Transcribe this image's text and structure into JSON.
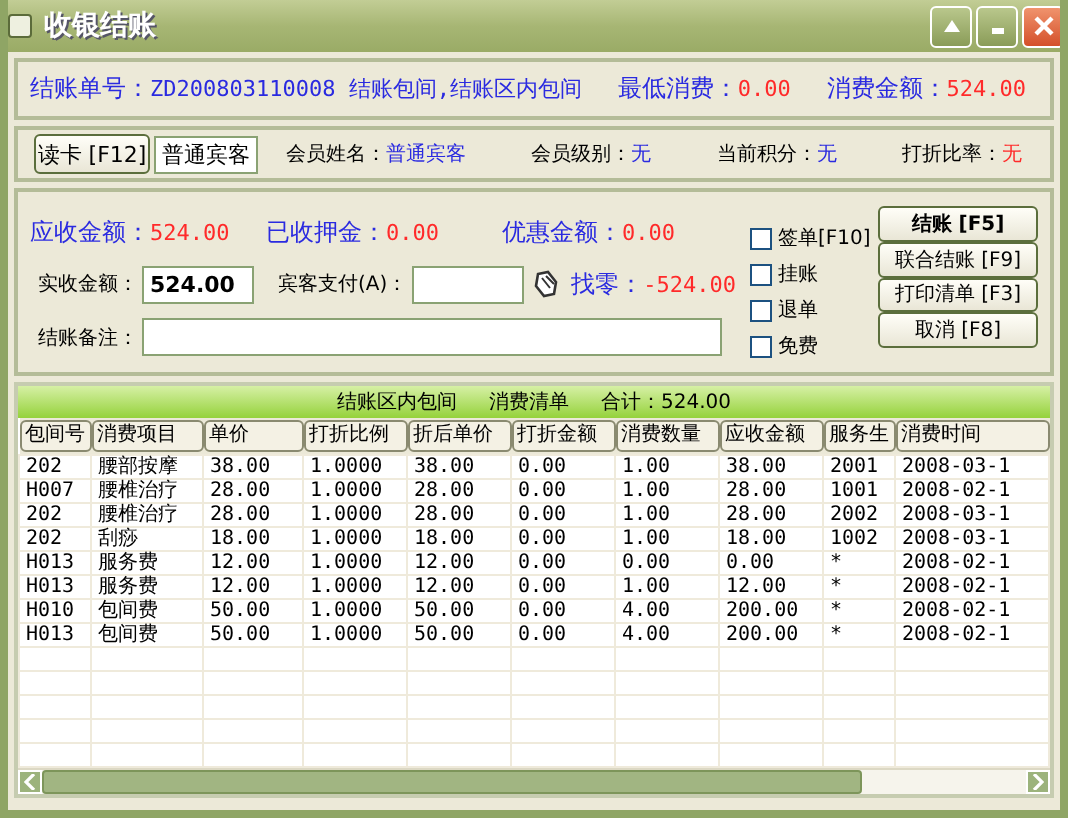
{
  "window": {
    "title": "收银结账"
  },
  "summary": [
    {
      "label": "结账单号：",
      "value": "ZD200803110008 结账包间,结账区内包间",
      "color": "#2a2ae0"
    },
    {
      "label": "最低消费：",
      "value": "0.00",
      "color": "#ff2a2a"
    },
    {
      "label": "消费金额：",
      "value": "524.00",
      "color": "#ff2a2a"
    }
  ],
  "member": {
    "card_button": "读卡 [F12]",
    "card_field": "普通宾客",
    "info": [
      {
        "label": "会员姓名：",
        "value": "普通宾客",
        "color": "#2a2ae0"
      },
      {
        "label": "会员级别：",
        "value": "无",
        "color": "#2a2ae0"
      },
      {
        "label": "当前积分：",
        "value": "无",
        "color": "#2a2ae0"
      },
      {
        "label": "打折比率：",
        "value": "无",
        "color": "#ff2a2a"
      }
    ]
  },
  "amounts": [
    {
      "label": "应收金额：",
      "value": "524.00"
    },
    {
      "label": "已收押金：",
      "value": "0.00"
    },
    {
      "label": "优惠金额：",
      "value": "0.00"
    }
  ],
  "paid": {
    "label": "实收金额：",
    "value": "524.00"
  },
  "guest_pay": {
    "label": "宾客支付(A)："
  },
  "change": {
    "label": "找零：",
    "value": "-524.00"
  },
  "remark": {
    "label": "结账备注："
  },
  "options": [
    {
      "label": "签单[F10]",
      "checked": false
    },
    {
      "label": "挂账",
      "checked": false
    },
    {
      "label": "退单",
      "checked": false
    },
    {
      "label": "免费",
      "checked": false
    }
  ],
  "buttons": [
    {
      "label": "结账 [F5]",
      "default": true
    },
    {
      "label": "联合结账 [F9]",
      "default": false
    },
    {
      "label": "打印清单 [F3]",
      "default": false
    },
    {
      "label": "取消 [F8]",
      "default": false
    }
  ],
  "table": {
    "caption": [
      "结账区内包间",
      "消费清单",
      "合计：524.00"
    ],
    "columns": [
      "包间号",
      "消费项目",
      "单价",
      "打折比例",
      "折后单价",
      "打折金额",
      "消费数量",
      "应收金额",
      "服务生",
      "消费时间"
    ],
    "rows": [
      [
        "202",
        "腰部按摩",
        "38.00",
        "1.0000",
        "38.00",
        "0.00",
        "1.00",
        "38.00",
        "2001",
        "2008-03-1"
      ],
      [
        "H007",
        "腰椎治疗",
        "28.00",
        "1.0000",
        "28.00",
        "0.00",
        "1.00",
        "28.00",
        "1001",
        "2008-02-1"
      ],
      [
        "202",
        "腰椎治疗",
        "28.00",
        "1.0000",
        "28.00",
        "0.00",
        "1.00",
        "28.00",
        "2002",
        "2008-03-1"
      ],
      [
        "202",
        "刮痧",
        "18.00",
        "1.0000",
        "18.00",
        "0.00",
        "1.00",
        "18.00",
        "1002",
        "2008-03-1"
      ],
      [
        "H013",
        "服务费",
        "12.00",
        "1.0000",
        "12.00",
        "0.00",
        "0.00",
        "0.00",
        "*",
        "2008-02-1"
      ],
      [
        "H013",
        "服务费",
        "12.00",
        "1.0000",
        "12.00",
        "0.00",
        "1.00",
        "12.00",
        "*",
        "2008-02-1"
      ],
      [
        "H010",
        "包间费",
        "50.00",
        "1.0000",
        "50.00",
        "0.00",
        "4.00",
        "200.00",
        "*",
        "2008-02-1"
      ],
      [
        "H013",
        "包间费",
        "50.00",
        "1.0000",
        "50.00",
        "0.00",
        "4.00",
        "200.00",
        "*",
        "2008-02-1"
      ]
    ]
  }
}
